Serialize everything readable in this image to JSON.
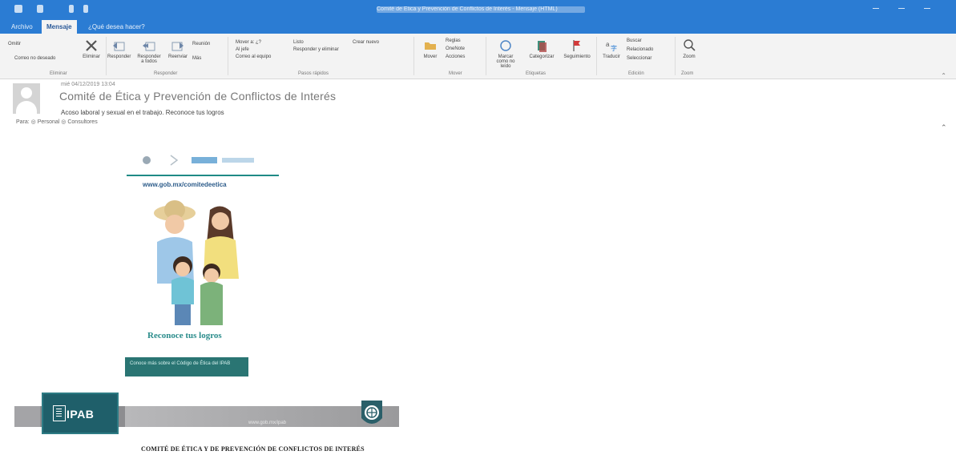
{
  "window": {
    "title": "Comité de Ética y Prevención de Conflictos de Interés - Mensaje (HTML)"
  },
  "ribbon": {
    "tabs": [
      {
        "label": "Archivo",
        "active": false
      },
      {
        "label": "Mensaje",
        "active": true
      },
      {
        "label": "¿Qué desea hacer?",
        "active": false
      }
    ],
    "groups": {
      "delete": {
        "ignore": "Omitir",
        "junk": "Correo no deseado",
        "delete": "Eliminar",
        "label": "Eliminar"
      },
      "respond": {
        "reply": "Responder",
        "reply_all": "Responder a todos",
        "forward": "Reenviar",
        "meeting": "Reunión",
        "more": "Más",
        "label": "Responder"
      },
      "quick_steps": {
        "items": [
          "Mover a: ¿?",
          "Al jefe",
          "Correo al equipo",
          "Listo",
          "Responder y eliminar",
          "Crear nuevo"
        ],
        "label": "Pasos rápidos"
      },
      "move": {
        "move": "Mover",
        "rules": "Reglas",
        "onenote": "OneNote",
        "actions": "Acciones",
        "label": "Mover"
      },
      "tags": {
        "unread": "Marcar como no leído",
        "categorize": "Categorizar",
        "follow_up": "Seguimiento",
        "label": "Etiquetas"
      },
      "editing": {
        "translate": "Traducir",
        "find": "Buscar",
        "related": "Relacionado",
        "select": "Seleccionar",
        "label": "Edición"
      },
      "zoom": {
        "zoom": "Zoom",
        "label": "Zoom"
      }
    }
  },
  "message": {
    "date": "mié 04/12/2019 13:04",
    "sender": "Comité de Ética y Prevención de Conflictos de Interés",
    "subject": "Acoso laboral y sexual en el trabajo. Reconoce tus logros",
    "recipients": "Para: ◎ Personal ◎ Consultores",
    "body": {
      "website": "www.gob.mx/comitedeetica",
      "slogan": "Reconoce tus logros",
      "cta": "Conoce más sobre el Código de Ética del IPAB",
      "brand": "IPAB",
      "footer_note": "www.gob.mx/ipab",
      "committee": "COMITÉ DE ÉTICA Y DE PREVENCIÓN DE CONFLICTOS DE INTERÉS"
    }
  },
  "colors": {
    "titlebar": "#2b7cd3",
    "ribbon_bg": "#f3f3f3",
    "teal": "#2a8c8b",
    "footer_gray": "#8d8d90",
    "ipab_box": "#1f5f6a"
  }
}
